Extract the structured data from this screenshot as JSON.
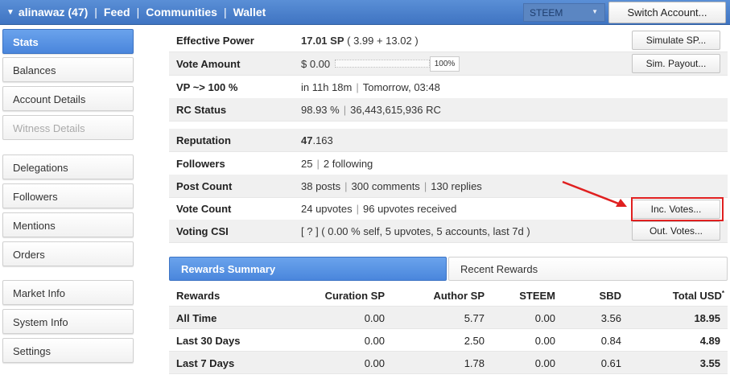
{
  "topbar": {
    "account": "alinawaz (47)",
    "nav": [
      "Feed",
      "Communities",
      "Wallet"
    ],
    "chain": "STEEM",
    "switch_label": "Switch Account..."
  },
  "sidebar": {
    "items": [
      {
        "label": "Stats",
        "state": "active"
      },
      {
        "label": "Balances",
        "state": "normal"
      },
      {
        "label": "Account Details",
        "state": "normal"
      },
      {
        "label": "Witness Details",
        "state": "disabled"
      },
      {
        "label": "Delegations",
        "state": "normal"
      },
      {
        "label": "Followers",
        "state": "normal"
      },
      {
        "label": "Mentions",
        "state": "normal"
      },
      {
        "label": "Orders",
        "state": "normal"
      },
      {
        "label": "Market Info",
        "state": "normal"
      },
      {
        "label": "System Info",
        "state": "normal"
      },
      {
        "label": "Settings",
        "state": "normal"
      }
    ]
  },
  "stats": {
    "effective_power": {
      "label": "Effective Power",
      "value": "17.01 SP",
      "detail": "( 3.99 + 13.02 )",
      "button": "Simulate SP..."
    },
    "vote_amount": {
      "label": "Vote Amount",
      "value": "$ 0.00",
      "pct": "100%",
      "button": "Sim. Payout..."
    },
    "vp": {
      "label": "VP ~> 100 %",
      "in": "in 11h 18m",
      "when": "Tomorrow, 03:48"
    },
    "rc": {
      "label": "RC Status",
      "pct": "98.93 %",
      "amount": "36,443,615,936 RC"
    },
    "reputation": {
      "label": "Reputation",
      "int": "47",
      "dec": ".163"
    },
    "followers": {
      "label": "Followers",
      "count": "25",
      "following": "2 following"
    },
    "post_count": {
      "label": "Post Count",
      "posts": "38 posts",
      "comments": "300 comments",
      "replies": "130 replies"
    },
    "vote_count": {
      "label": "Vote Count",
      "up": "24 upvotes",
      "received": "96 upvotes received",
      "button": "Inc. Votes..."
    },
    "voting_csi": {
      "label": "Voting CSI",
      "value": "[ ? ] ( 0.00 % self, 5 upvotes, 5 accounts, last 7d )",
      "button": "Out. Votes..."
    }
  },
  "rewards": {
    "tabs": [
      "Rewards Summary",
      "Recent Rewards"
    ],
    "columns": [
      "Rewards",
      "Curation SP",
      "Author SP",
      "STEEM",
      "SBD",
      "Total USD"
    ],
    "asterisk": "*",
    "rows": [
      [
        "All Time",
        "0.00",
        "5.77",
        "0.00",
        "3.56",
        "18.95"
      ],
      [
        "Last 30 Days",
        "0.00",
        "2.50",
        "0.00",
        "0.84",
        "4.89"
      ],
      [
        "Last 7 Days",
        "0.00",
        "1.78",
        "0.00",
        "0.61",
        "3.55"
      ]
    ]
  },
  "colors": {
    "accent": "#4a86dc",
    "topbar": "#3f74c2",
    "annotation": "#e02020"
  }
}
